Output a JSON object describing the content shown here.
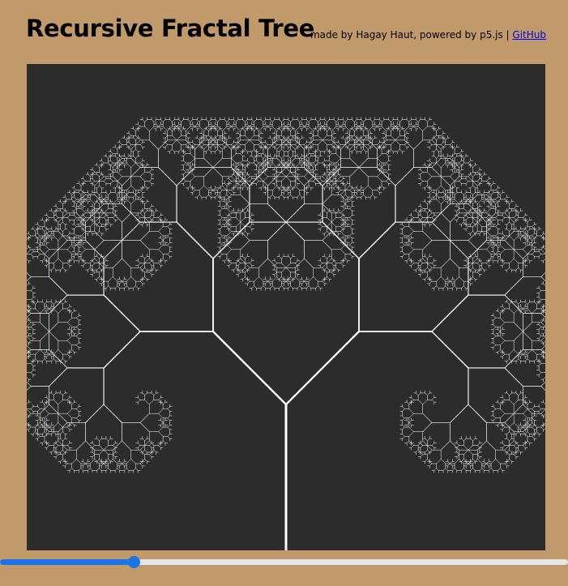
{
  "header": {
    "title": "Recursive Fractal Tree",
    "credit_text": "made by Hagay Haut, powered by p5.js | ",
    "github_link": "GitHub"
  },
  "canvas": {
    "background": "#2c2c2c",
    "stroke": "#ffffff"
  },
  "angle_slider": {
    "value_fraction": 0.235,
    "fill_color": "#1a73e8",
    "track_color": "#e6e6e6"
  }
}
